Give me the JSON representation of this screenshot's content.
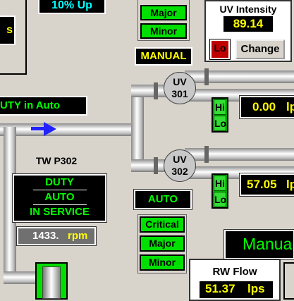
{
  "top_left": {
    "trend": "10% Up",
    "partial_label": "s"
  },
  "alarms_top": {
    "major": "Major",
    "minor": "Minor"
  },
  "mode_manual": "MANUAL",
  "uv_intensity": {
    "title": "UV Intensity",
    "value": "89.14",
    "lo": "Lo",
    "change": "Change"
  },
  "duty_in_auto": "UTY in Auto",
  "uv301": {
    "line1": "UV",
    "line2": "301",
    "hi": "Hi",
    "lo": "Lo",
    "flow": "0.00",
    "unit": "lp"
  },
  "uv302": {
    "line1": "UV",
    "line2": "302",
    "hi": "Hi",
    "lo": "Lo",
    "flow": "57.05",
    "unit": "lp"
  },
  "pump": {
    "name": "TW P302",
    "duty": "DUTY",
    "auto": "AUTO",
    "service": "IN SERVICE",
    "speed": "1433.",
    "speed_unit": "rpm"
  },
  "mode_auto": "AUTO",
  "alarms_bottom": {
    "critical": "Critical",
    "major": "Major",
    "minor": "Minor"
  },
  "manual_right": "Manua",
  "rw_flow": {
    "title": "RW Flow",
    "value": "51.37",
    "unit": "lps"
  },
  "colors": {
    "background": "#d8d4cc",
    "alarm_green": "#00e000",
    "text_yellow": "#ffff00",
    "text_green": "#00ff00",
    "flow_arrow": "#2222ff"
  }
}
